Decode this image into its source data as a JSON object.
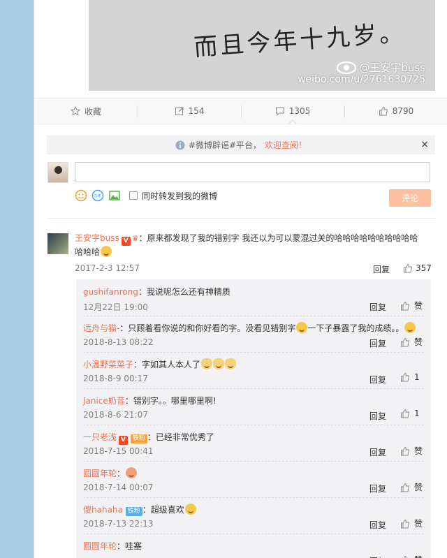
{
  "image": {
    "handwriting_line1": "…",
    "handwriting_line2": "而且今年十九岁。",
    "watermark_handle": "@王安宇buss",
    "watermark_url": "weibo.com/u/2761630725"
  },
  "actions": {
    "favorite_label": "收藏",
    "repost_count": "154",
    "comment_count": "1305",
    "like_count": "8790"
  },
  "notice": {
    "prefix": "#微博辟谣#平台，",
    "highlight": "欢迎查阅！",
    "close": "×"
  },
  "composer": {
    "placeholder": "",
    "repost_label": "同时转发到我的微博",
    "submit_label": "评论"
  },
  "main_comment": {
    "user": "王安宇buss",
    "text_line1": "：原来都发现了我的错别字 我还以为可以蒙混过关的哈哈哈哈哈哈哈哈哈哈",
    "text_line2": "哈哈哈",
    "time": "2017-2-3 12:57",
    "reply_label": "回复",
    "likes": "357"
  },
  "replies": [
    {
      "user": "gushifanrong",
      "text": "：我说呢怎么还有神精质",
      "time": "12月22日 19:00",
      "reply_label": "回复",
      "likes": "赞"
    },
    {
      "user": "远舟与猫-",
      "text": "：只顾着看你说的和你好看的字。没看见错别字",
      "text2": "一下子暴露了我的成绩。。",
      "time": "2018-8-13 08:22",
      "reply_label": "回复",
      "likes": "赞"
    },
    {
      "user": "小温野菜菜子",
      "text": "：字如其人本人了",
      "time": "2018-8-9 00:17",
      "reply_label": "回复",
      "likes": "1"
    },
    {
      "user": "Janice奶昔",
      "text": "：错别字。。哪里哪里啊!",
      "time": "2018-8-6 21:07",
      "reply_label": "回复",
      "likes": "1"
    },
    {
      "user": "一只老浅",
      "badge": "铁粉",
      "text": "：已经非常优秀了",
      "time": "2018-7-15 00:41",
      "reply_label": "回复",
      "likes": "赞"
    },
    {
      "user": "圆圆年轮",
      "text": "：",
      "time": "2018-7-14 00:07",
      "reply_label": "回复",
      "likes": "赞"
    },
    {
      "user": "傻hahaha",
      "badge": "铁粉",
      "text": "：超级喜欢",
      "time": "2018-7-13 22:13",
      "reply_label": "回复",
      "likes": "赞"
    },
    {
      "user": "圆圆年轮",
      "text": "：哇塞",
      "time": "",
      "reply_label": "回复",
      "likes": "赞"
    }
  ],
  "colors": {
    "page_bg": "#a9cde3",
    "link_orange": "#eb7350",
    "reply_bg": "#f2f2f5",
    "submit_disabled": "#ffc09f"
  }
}
